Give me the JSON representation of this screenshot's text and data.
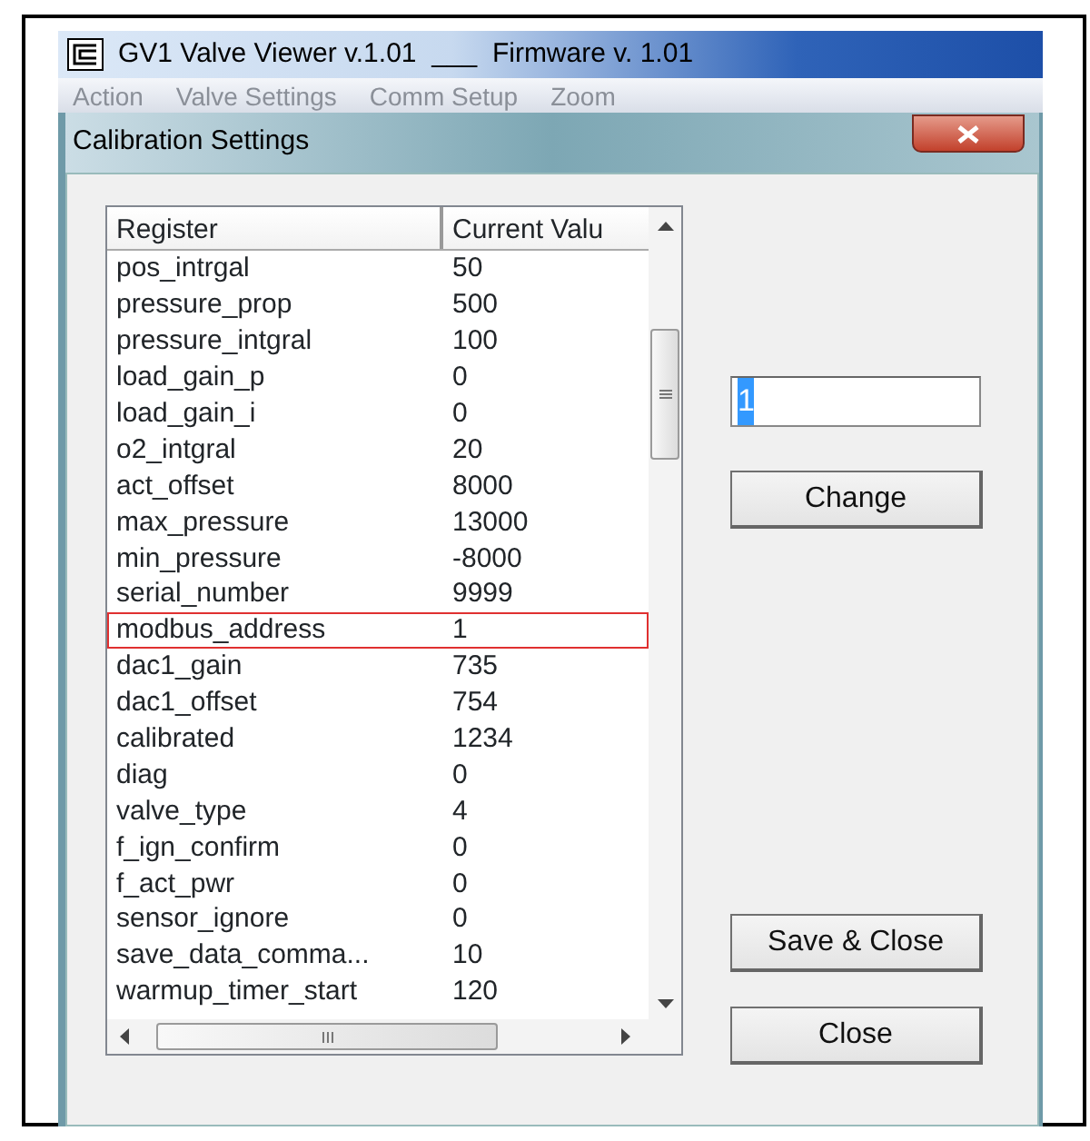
{
  "window": {
    "title": "GV1 Valve Viewer v.1.01  ___  Firmware v. 1.01"
  },
  "menu": [
    {
      "label": "Action",
      "disabled": true
    },
    {
      "label": "Valve Settings",
      "disabled": true
    },
    {
      "label": "Comm Setup",
      "disabled": true
    },
    {
      "label": "Zoom",
      "disabled": true
    }
  ],
  "dialog": {
    "title": "Calibration Settings"
  },
  "table": {
    "columns": [
      "Register",
      "Current Valu"
    ],
    "rows": [
      {
        "register": "pos_intrgal",
        "value": "50",
        "highlighted": false
      },
      {
        "register": "pressure_prop",
        "value": "500",
        "highlighted": false
      },
      {
        "register": "pressure_intgral",
        "value": "100",
        "highlighted": false
      },
      {
        "register": "load_gain_p",
        "value": "0",
        "highlighted": false
      },
      {
        "register": "load_gain_i",
        "value": "0",
        "highlighted": false
      },
      {
        "register": "o2_intgral",
        "value": "20",
        "highlighted": false
      },
      {
        "register": "act_offset",
        "value": "8000",
        "highlighted": false
      },
      {
        "register": "max_pressure",
        "value": "13000",
        "highlighted": false
      },
      {
        "register": "min_pressure",
        "value": "-8000",
        "highlighted": false
      },
      {
        "register": "serial_number",
        "value": "9999",
        "highlighted": false
      },
      {
        "register": "modbus_address",
        "value": "1",
        "highlighted": true
      },
      {
        "register": "dac1_gain",
        "value": "735",
        "highlighted": false
      },
      {
        "register": "dac1_offset",
        "value": "754",
        "highlighted": false
      },
      {
        "register": "calibrated",
        "value": "1234",
        "highlighted": false
      },
      {
        "register": "diag",
        "value": "0",
        "highlighted": false
      },
      {
        "register": "valve_type",
        "value": "4",
        "highlighted": false
      },
      {
        "register": "f_ign_confirm",
        "value": "0",
        "highlighted": false
      },
      {
        "register": "f_act_pwr",
        "value": "0",
        "highlighted": false
      },
      {
        "register": "sensor_ignore",
        "value": "0",
        "highlighted": false
      },
      {
        "register": "save_data_comma...",
        "value": "10",
        "highlighted": false
      },
      {
        "register": "warmup_timer_start",
        "value": "120",
        "highlighted": false
      }
    ]
  },
  "value_field": {
    "value": "1",
    "text_selected": true
  },
  "buttons": [
    {
      "label": "Change"
    },
    {
      "label": "Save & Close"
    },
    {
      "label": "Close"
    }
  ]
}
